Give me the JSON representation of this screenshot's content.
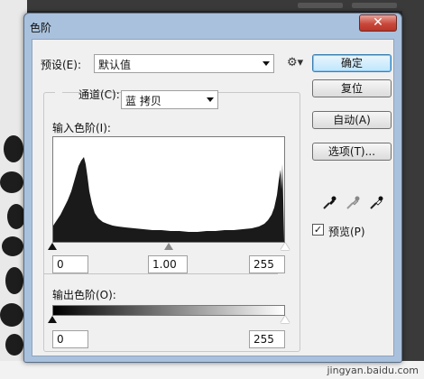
{
  "dialog": {
    "title": "色阶",
    "close_label": "✕"
  },
  "preset": {
    "label": "预设(E):",
    "value": "默认值"
  },
  "channel": {
    "label": "通道(C):",
    "value": "蓝 拷贝"
  },
  "input_levels": {
    "label": "输入色阶(I):",
    "black": "0",
    "gamma": "1.00",
    "white": "255"
  },
  "output_levels": {
    "label": "输出色阶(O):",
    "black": "0",
    "white": "255"
  },
  "buttons": {
    "ok": "确定",
    "reset": "复位",
    "auto": "自动(A)",
    "options": "选项(T)..."
  },
  "preview": {
    "label": "预览(P)",
    "checked": true
  },
  "background": {
    "url": "jingyan.baidu.com"
  }
}
